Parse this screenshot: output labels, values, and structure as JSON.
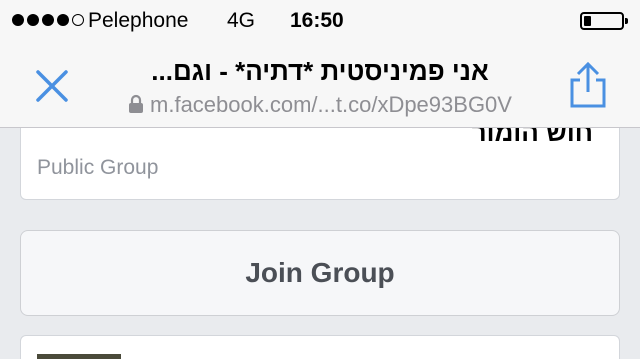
{
  "status_bar": {
    "signal_strength": 4,
    "signal_max": 5,
    "carrier": "Pelephone",
    "network": "4G",
    "time": "16:50",
    "battery_level": 0.2
  },
  "browser": {
    "close_icon": "close-icon",
    "title": "אני פמיניסטית *דתיה* - וגם...",
    "lock_icon": "lock-icon",
    "url": "m.facebook.com/...t.co/xDpe93BG0V",
    "share_icon": "share-icon",
    "accent_color": "#4a90e2"
  },
  "group": {
    "name": "חוש הומור",
    "type": "Public Group",
    "join_label": "Join Group"
  }
}
